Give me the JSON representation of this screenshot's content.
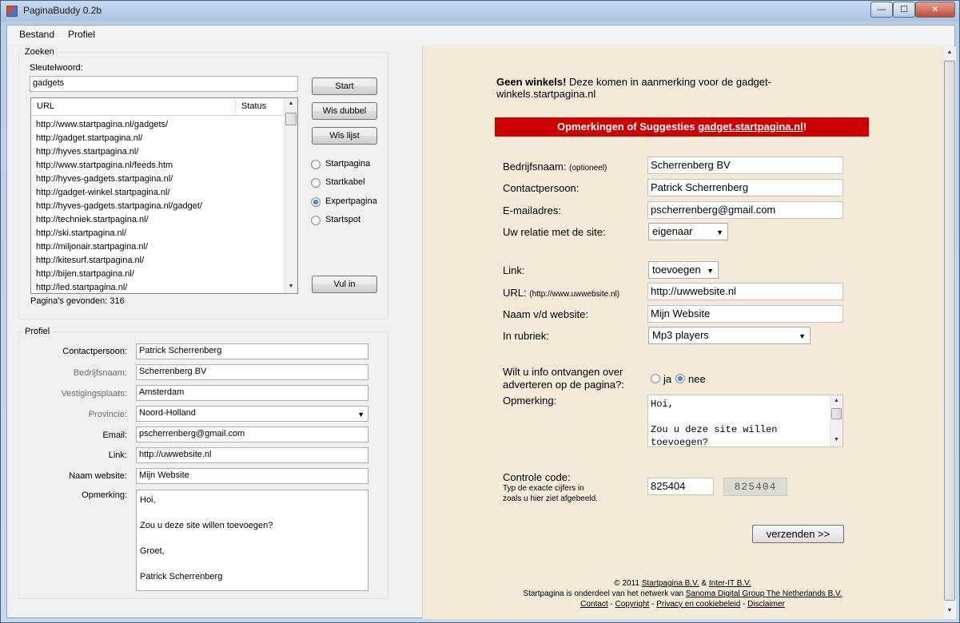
{
  "window": {
    "title": "PaginaBuddy 0.2b",
    "min_label": "—",
    "max_label": "☐",
    "close_label": "✕"
  },
  "menu": [
    "Bestand",
    "Profiel"
  ],
  "zoeken": {
    "legend": "Zoeken",
    "keyword_label": "Sleutelwoord:",
    "keyword_value": "gadgets",
    "columns": [
      "URL",
      "Status"
    ],
    "urls": [
      "http://www.startpagina.nl/gadgets/",
      "http://gadget.startpagina.nl/",
      "http://hyves.startpagina.nl/",
      "http://www.startpagina.nl/feeds.htm",
      "http://hyves-gadgets.startpagina.nl/",
      "http://gadget-winkel.startpagina.nl/",
      "http://hyves-gadgets.startpagina.nl/gadget/",
      "http://techniek.startpagina.nl/",
      "http://ski.startpagina.nl/",
      "http://miljonair.startpagina.nl/",
      "http://kitesurf.startpagina.nl/",
      "http://bijen.startpagina.nl/",
      "http://led.startpagina.nl/"
    ],
    "found_label": "Pagina's gevonden: 316",
    "buttons": {
      "start": "Start",
      "wis_dubbel": "Wis dubbel",
      "wis_lijst": "Wis lijst",
      "vul_in": "Vul in"
    },
    "radios": [
      {
        "label": "Startpagina",
        "checked": false
      },
      {
        "label": "Startkabel",
        "checked": false
      },
      {
        "label": "Expertpagina",
        "checked": true
      },
      {
        "label": "Startspot",
        "checked": false
      }
    ]
  },
  "profiel": {
    "legend": "Profiel",
    "fields": [
      {
        "label": "Contactpersoon:",
        "value": "Patrick Scherrenberg"
      },
      {
        "label": "Bedrijfsnaam:",
        "value": "Scherrenberg BV"
      },
      {
        "label": "Vestigingsplaats:",
        "value": "Amsterdam"
      },
      {
        "label": "Provincie:",
        "value": "Noord-Holland"
      },
      {
        "label": "Email:",
        "value": "pscherrenberg@gmail.com"
      },
      {
        "label": "Link:",
        "value": "http://uwwebsite.nl"
      },
      {
        "label": "Naam website:",
        "value": "Mijn Website"
      }
    ],
    "remark_label": "Opmerking:",
    "remark_lines": [
      "Hoi,",
      "",
      "Zou u deze site willen toevoegen?",
      "",
      "Groet,",
      "",
      "Patrick Scherrenberg"
    ]
  },
  "web": {
    "notice_bold": "Geen winkels!",
    "notice_line1": " Deze komen in aanmerking voor de gadget-",
    "notice_line2": "winkels.startpagina.nl",
    "banner_text": "Opmerkingen of Suggesties ",
    "banner_link": "gadget.startpagina.nl",
    "banner_end": "!",
    "bedrijfsnaam_label": "Bedrijfsnaam:",
    "optioneel": "(optioneel)",
    "bedrijfsnaam_value": "Scherrenberg BV",
    "contact_label": "Contactpersoon:",
    "contact_value": "Patrick Scherrenberg",
    "email_label": "E-mailadres:",
    "email_value": "pscherrenberg@gmail.com",
    "relatie_label": "Uw relatie met de site:",
    "relatie_value": "eigenaar",
    "link_label": "Link:",
    "link_value": "toevoegen",
    "url_label": "URL:",
    "url_hint": "(http://www.uwwebsite.nl)",
    "url_value": "http://uwwebsite.nl",
    "naam_label": "Naam v/d website:",
    "naam_value": "Mijn Website",
    "rubriek_label": "In rubriek:",
    "rubriek_value": "Mp3 players",
    "info_line1": "Wilt u info ontvangen over",
    "info_line2": "adverteren op de pagina?:",
    "ja": "ja",
    "nee": "nee",
    "opmerking_label": "Opmerking:",
    "opmerking_lines": [
      "Hoi,",
      "",
      "Zou u deze site willen",
      "toevoegen?"
    ],
    "controle_label": "Controle code:",
    "controle_hint1": "Typ de exacte cijfers in",
    "controle_hint2": "zoals u hier ziet afgebeeld.",
    "controle_value": "825404",
    "captcha": "825404",
    "submit": "verzenden >>",
    "footer_copy": "© 2011 ",
    "footer_sp": "Startpagina B.V.",
    "footer_amp": " & ",
    "footer_inter": "Inter-IT B.V.",
    "footer_line2a": "Startpagina is onderdeel van het netwerk van ",
    "footer_sanoma": "Sanoma Digital Group The Netherlands B.V.",
    "footer_contact": "Contact",
    "footer_copyright": "Copyright",
    "footer_privacy": "Privacy en cookiebeleid",
    "footer_disclaimer": "Disclaimer",
    "footer_sep": " - "
  },
  "colors": {
    "banner_red": "#cc0000",
    "web_bg": "#f3ead7"
  }
}
